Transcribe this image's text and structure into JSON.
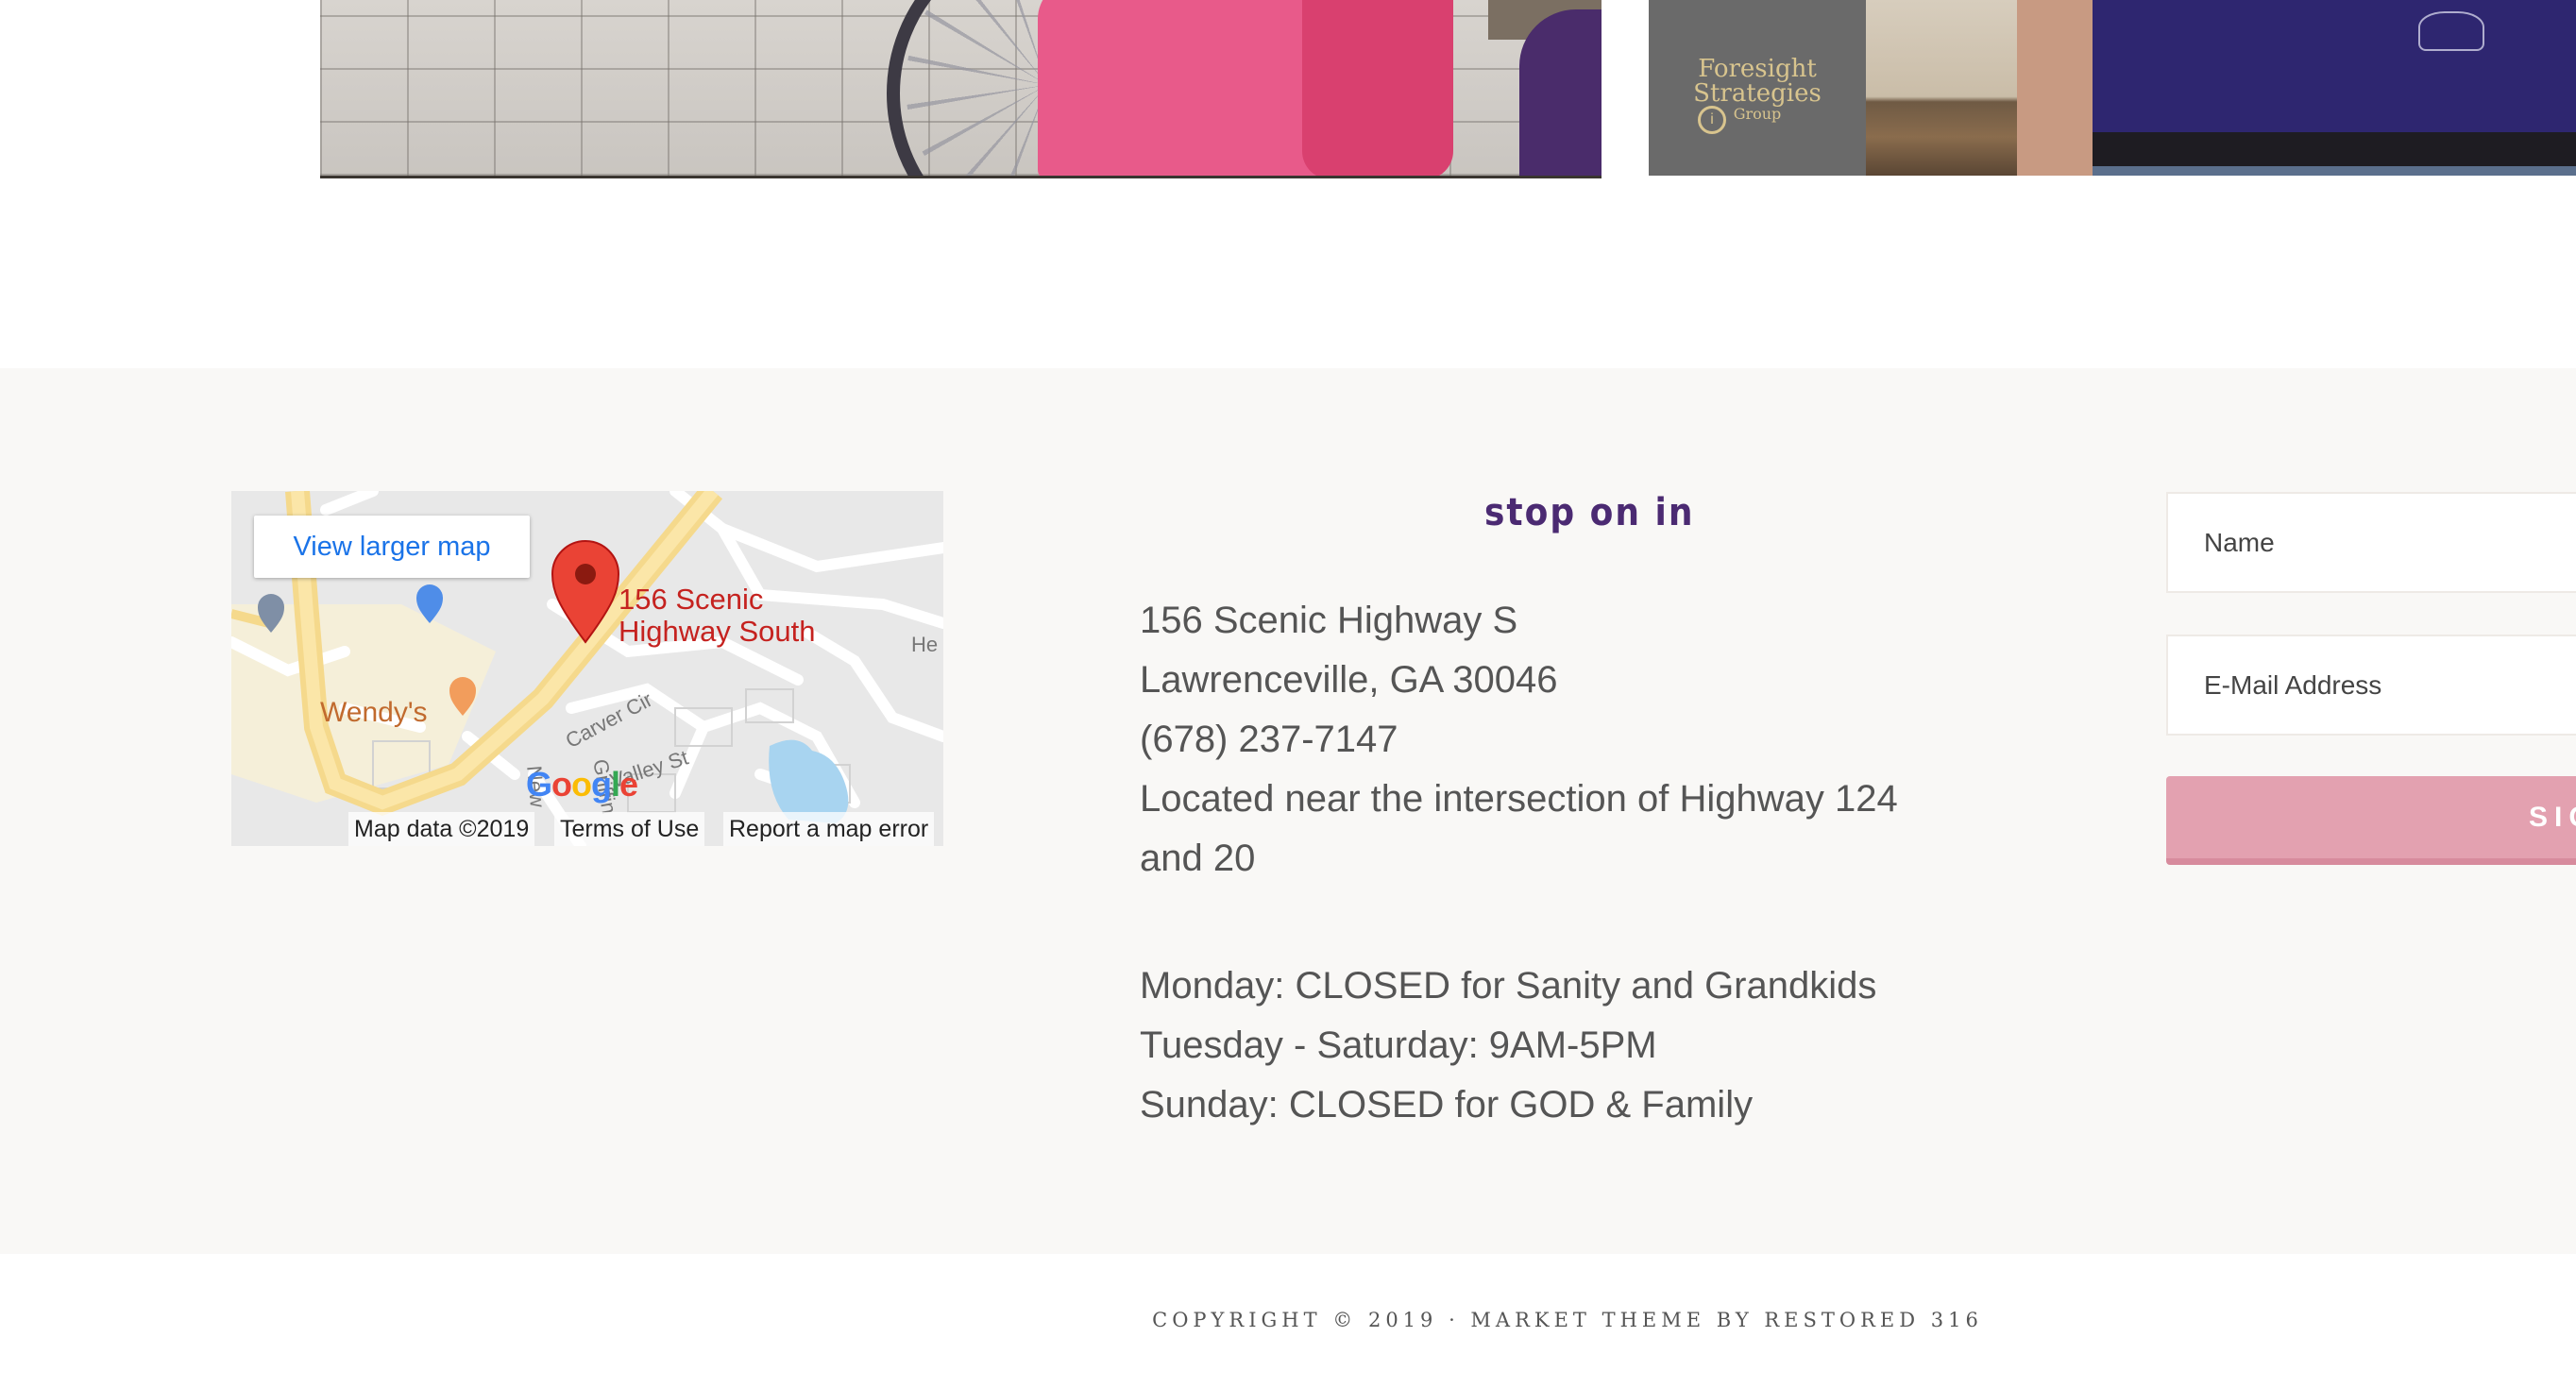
{
  "map": {
    "view_larger_label": "View larger map",
    "place_line1": "156 Scenic",
    "place_line2": "Highway South",
    "poi_wendys": "Wendy's",
    "streets": {
      "carver": "Carver Cir",
      "valley": "Valley St",
      "griffin": "Griffin",
      "new": "New",
      "he": "He"
    },
    "google_logo": "Google",
    "attribution": {
      "map_data": "Map data ©2019",
      "terms": "Terms of Use",
      "report": "Report a map error"
    }
  },
  "info": {
    "heading": "stop on in",
    "address_line1": "156 Scenic Highway S",
    "address_line2": "Lawrenceville, GA 30046",
    "phone": "(678) 237-7147",
    "location_note_line1": "Located near the intersection of Highway 124",
    "location_note_line2": "and 20",
    "hours": [
      "Monday: CLOSED for Sanity and Grandkids",
      "Tuesday - Saturday: 9AM-5PM",
      "Sunday: CLOSED for GOD & Family"
    ]
  },
  "signup": {
    "name_placeholder": "Name",
    "email_placeholder": "E-Mail Address",
    "button_label": "SIGN UP"
  },
  "photos": {
    "right_logo_line1": "Foresight",
    "right_logo_line2": "Strategies",
    "right_logo_line3": "Group"
  },
  "footer": {
    "copyright": "COPYRIGHT © 2019 · MARKET THEME BY RESTORED 316"
  },
  "colors": {
    "heading": "#4b2a72",
    "button": "#e3a1b0",
    "band": "#f9f8f6",
    "map_link": "#1a73e8",
    "map_pin": "#c5221f"
  }
}
